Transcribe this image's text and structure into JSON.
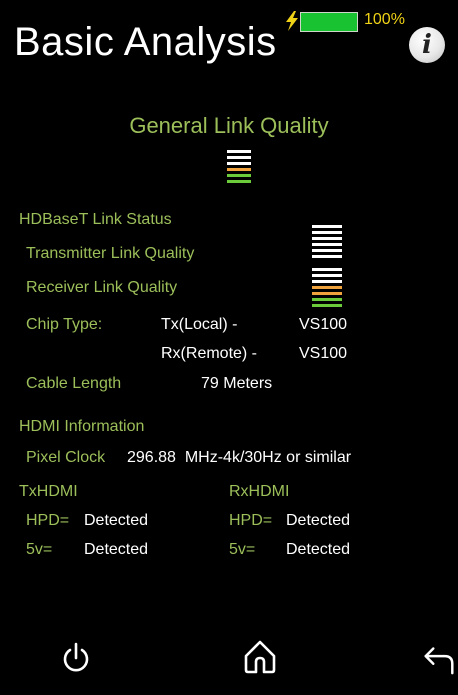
{
  "header": {
    "title": "Basic Analysis",
    "battery_percent": "100%",
    "battery_level": 1.0,
    "info_icon": "info-icon"
  },
  "general": {
    "title": "General Link Quality",
    "quality_icon": "link-quality-bars-icon"
  },
  "hdbaset": {
    "section_title": "HDBaseT Link Status",
    "transmitter_label": "Transmitter Link Quality",
    "receiver_label": "Receiver Link Quality",
    "chip_type_label": "Chip Type:",
    "tx_label": "Tx(Local) -",
    "tx_value": "VS100",
    "rx_label": "Rx(Remote) -",
    "rx_value": "VS100",
    "cable_length_label": "Cable Length",
    "cable_length_value": "79 Meters"
  },
  "hdmi": {
    "section_title": "HDMI Information",
    "pixel_clock_label": "Pixel Clock",
    "pixel_clock_value": "296.88  MHz-4k/30Hz or similar",
    "tx_title": "TxHDMI",
    "rx_title": "RxHDMI",
    "tx_hpd_label": "HPD=",
    "tx_hpd_value": "Detected",
    "tx_5v_label": "5v=",
    "tx_5v_value": "Detected",
    "rx_hpd_label": "HPD=",
    "rx_hpd_value": "Detected",
    "rx_5v_label": "5v=",
    "rx_5v_value": "Detected"
  },
  "nav": {
    "power_icon": "power-icon",
    "home_icon": "home-icon",
    "back_icon": "back-arrow-icon"
  },
  "colors": {
    "accent_green": "#9cbf5a",
    "battery_green": "#19c231",
    "battery_text": "#f0d216",
    "bar_orange": "#f0a23c",
    "bar_green": "#6ccb3a"
  }
}
